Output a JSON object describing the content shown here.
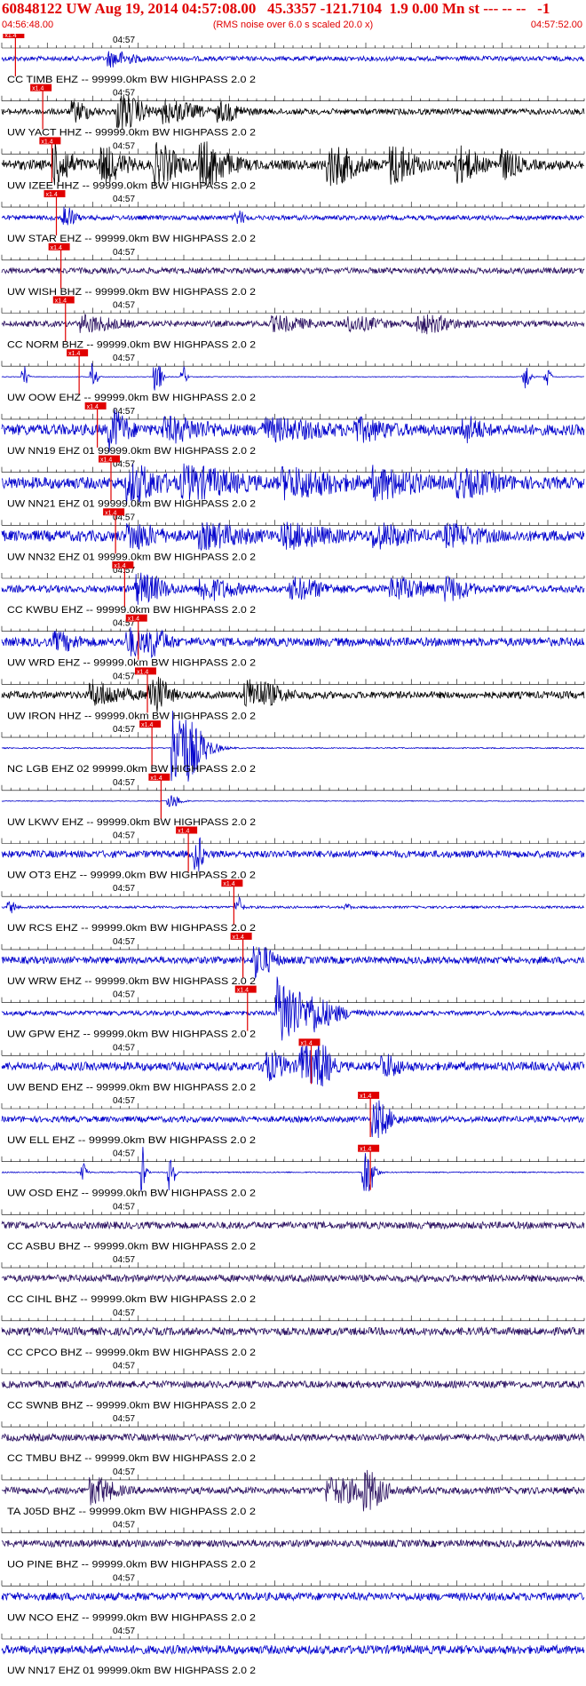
{
  "header": {
    "title": "60848122 UW Aug 19, 2014 04:57:08.00   45.3357 -121.7104  1.9 0.00 Mn st --- -- --   -1",
    "start_time": "04:56:48.00",
    "end_time": "04:57:52.00",
    "subtitle": "(RMS noise over 6.0 s scaled 20.0 x)"
  },
  "colors": {
    "title": "#e00000",
    "blue_trace": "#0000cc",
    "black_trace": "#000000",
    "purple_trace": "#2a1060",
    "pick": "#e00000",
    "tick": "#000000"
  },
  "chart_data": {
    "type": "line",
    "title": "60848122 UW Aug 19, 2014 04:57:08.00   45.3357 -121.7104  1.9 0.00 Mn st --- -- --   -1",
    "subtitle": "(RMS noise over 6.0 s scaled 20.0 x)",
    "xlim": [
      "04:56:48.00",
      "04:57:52.00"
    ],
    "tick_minute_label": "04:57",
    "pick_label": "x1.4",
    "series": [
      {
        "label": "CC TIMB EHZ -- 99999.0km BW  HIGHPASS  2.0  2",
        "color": "blue",
        "pick_s": 1.5,
        "amp": 0.12,
        "events": [
          [
            12,
            0.35,
            2.0
          ]
        ]
      },
      {
        "label": "UW YACT HHZ -- 99999.0km BW  HIGHPASS  2.0  2",
        "color": "black",
        "pick_s": 4.5,
        "amp": 0.15,
        "events": [
          [
            8,
            0.45,
            1.5
          ],
          [
            13,
            0.85,
            2.2
          ],
          [
            18,
            0.5,
            3.0
          ],
          [
            24,
            0.4,
            2.0
          ]
        ]
      },
      {
        "label": "UW IZEE HHZ -- 99999.0km BW  HIGHPASS  2.0  2",
        "color": "black",
        "pick_s": 5.5,
        "amp": 0.25,
        "events": [
          [
            6,
            0.9,
            1.5
          ],
          [
            11,
            0.8,
            2.0
          ],
          [
            17,
            0.9,
            2.0
          ],
          [
            22,
            1.0,
            2.5
          ],
          [
            36,
            0.9,
            2.5
          ],
          [
            43,
            0.9,
            2.0
          ],
          [
            50,
            0.8,
            2.0
          ],
          [
            55,
            0.6,
            1.5
          ]
        ]
      },
      {
        "label": "UW STAR EHZ -- 99999.0km BW  HIGHPASS  2.0  2",
        "color": "blue",
        "pick_s": 6.0,
        "amp": 0.12,
        "events": [
          [
            7,
            0.6,
            0.8
          ],
          [
            26,
            0.3,
            0.6
          ]
        ]
      },
      {
        "label": "UW WISH BHZ -- 99999.0km BW  HIGHPASS  2.0  2",
        "color": "purple",
        "pick_s": 6.5,
        "amp": 0.15,
        "events": []
      },
      {
        "label": "CC NORM BHZ -- 99999.0km BW  HIGHPASS  2.0  2",
        "color": "purple",
        "pick_s": 7.0,
        "amp": 0.15,
        "events": [
          [
            9,
            0.35,
            3.0
          ],
          [
            30,
            0.3,
            3.0
          ],
          [
            38,
            0.3,
            3.0
          ],
          [
            46,
            0.4,
            3.0
          ]
        ]
      },
      {
        "label": "UW OOW EHZ -- 99999.0km BW  HIGHPASS  2.0  2",
        "color": "blue",
        "pick_s": 8.5,
        "amp": 0.02,
        "events": [
          [
            2.5,
            0.6,
            0.3
          ],
          [
            10,
            0.8,
            0.4
          ],
          [
            17,
            0.9,
            0.5
          ],
          [
            20,
            0.5,
            0.3
          ],
          [
            57.5,
            0.7,
            0.5
          ],
          [
            60,
            0.5,
            0.3
          ]
        ]
      },
      {
        "label": "UW NN19 EHZ 01 99999.0km BW  HIGHPASS  2.0  2",
        "color": "blue",
        "pick_s": 10.5,
        "amp": 0.28,
        "events": [
          [
            12,
            0.9,
            1.5
          ],
          [
            18,
            0.45,
            4.0
          ],
          [
            29,
            0.4,
            5.0
          ],
          [
            39,
            0.4,
            3.0
          ],
          [
            51,
            0.5,
            1.5
          ]
        ]
      },
      {
        "label": "UW NN21 EHZ 01 99999.0km BW  HIGHPASS  2.0  2",
        "color": "blue",
        "pick_s": 12.0,
        "amp": 0.3,
        "events": [
          [
            14,
            0.8,
            3.0
          ],
          [
            20,
            0.65,
            5.0
          ],
          [
            31,
            0.6,
            5.0
          ],
          [
            41,
            0.6,
            4.0
          ],
          [
            50,
            0.5,
            4.0
          ]
        ]
      },
      {
        "label": "UW NN32 EHZ 01 99999.0km BW  HIGHPASS  2.0  2",
        "color": "blue",
        "pick_s": 12.5,
        "amp": 0.28,
        "events": [
          [
            14,
            0.55,
            2.5
          ],
          [
            22,
            0.45,
            4.0
          ],
          [
            31,
            0.45,
            4.0
          ],
          [
            41,
            0.45,
            3.0
          ],
          [
            49,
            0.4,
            3.0
          ]
        ]
      },
      {
        "label": "CC KWBU EHZ -- 99999.0km BW  HIGHPASS  2.0  2",
        "color": "blue",
        "pick_s": 13.5,
        "amp": 0.18,
        "events": [
          [
            15,
            0.7,
            2.5
          ],
          [
            22,
            0.5,
            3.0
          ],
          [
            32,
            0.45,
            3.0
          ],
          [
            43,
            0.5,
            3.0
          ],
          [
            49,
            0.5,
            2.0
          ]
        ]
      },
      {
        "label": "UW WRD EHZ -- 99999.0km BW  HIGHPASS  2.0  2",
        "color": "blue",
        "pick_s": 15.0,
        "amp": 0.22,
        "events": [
          [
            6,
            0.35,
            2.0
          ],
          [
            14,
            0.6,
            2.0
          ],
          [
            16.5,
            0.5,
            1.5
          ]
        ]
      },
      {
        "label": "UW IRON HHZ -- 99999.0km BW  HIGHPASS  2.0  2",
        "color": "black",
        "pick_s": 16.0,
        "amp": 0.18,
        "events": [
          [
            10,
            0.5,
            3.0
          ],
          [
            16.5,
            1.0,
            1.5
          ],
          [
            27,
            0.7,
            3.0
          ]
        ]
      },
      {
        "label": "NC LGB EHZ 02 99999.0km BW  HIGHPASS  2.0  2",
        "color": "blue",
        "pick_s": 16.5,
        "amp": 0.03,
        "events": [
          [
            19,
            2.2,
            2.5
          ]
        ]
      },
      {
        "label": "UW LKWV EHZ -- 99999.0km BW  HIGHPASS  2.0  2",
        "color": "blue",
        "pick_s": 17.5,
        "amp": 0.02,
        "events": [
          [
            18.5,
            0.35,
            1.0
          ]
        ]
      },
      {
        "label": "UW OT3 EHZ -- 99999.0km BW  HIGHPASS  2.0  2",
        "color": "blue",
        "pick_s": 20.5,
        "amp": 0.18,
        "events": [
          [
            21.5,
            0.9,
            0.5
          ]
        ]
      },
      {
        "label": "UW RCS EHZ -- 99999.0km BW  HIGHPASS  2.0  2",
        "color": "blue",
        "pick_s": 25.5,
        "amp": 0.06,
        "events": [
          [
            1,
            0.3,
            0.5
          ],
          [
            26,
            0.5,
            0.4
          ],
          [
            38,
            0.15,
            0.3
          ]
        ]
      },
      {
        "label": "UW WRW EHZ -- 99999.0km BW  HIGHPASS  2.0  2",
        "color": "blue",
        "pick_s": 26.5,
        "amp": 0.18,
        "events": [
          [
            28,
            0.8,
            1.5
          ]
        ]
      },
      {
        "label": "UW GPW EHZ -- 99999.0km BW  HIGHPASS  2.0  2",
        "color": "blue",
        "pick_s": 27.0,
        "amp": 0.12,
        "events": [
          [
            30.5,
            1.8,
            2.5
          ],
          [
            34,
            0.6,
            3.0
          ]
        ]
      },
      {
        "label": "UW BEND EHZ -- 99999.0km BW  HIGHPASS  2.0  2",
        "color": "blue",
        "pick_s": 34.0,
        "amp": 0.22,
        "events": [
          [
            29,
            0.6,
            2.0
          ],
          [
            33,
            0.9,
            2.0
          ],
          [
            35,
            0.7,
            1.0
          ],
          [
            42,
            0.5,
            1.5
          ]
        ]
      },
      {
        "label": "UW ELL EHZ -- 99999.0km BW  HIGHPASS  2.0  2",
        "color": "blue",
        "pick_s": 40.5,
        "amp": 0.15,
        "events": [
          [
            41,
            0.9,
            1.5
          ]
        ]
      },
      {
        "label": "UW OSD EHZ -- 99999.0km BW  HIGHPASS  2.0  2",
        "color": "blue",
        "pick_s": 40.5,
        "amp": 0.03,
        "events": [
          [
            9,
            0.7,
            0.3
          ],
          [
            15.5,
            1.3,
            0.3
          ],
          [
            18.5,
            1.2,
            0.4
          ],
          [
            40,
            1.3,
            0.8
          ]
        ]
      },
      {
        "label": "CC ASBU BHZ -- 99999.0km BW  HIGHPASS  2.0  2",
        "color": "purple",
        "pick_s": null,
        "amp": 0.18,
        "events": []
      },
      {
        "label": "CC CIHL BHZ -- 99999.0km BW  HIGHPASS  2.0  2",
        "color": "purple",
        "pick_s": null,
        "amp": 0.18,
        "events": []
      },
      {
        "label": "CC CPCO BHZ -- 99999.0km BW  HIGHPASS  2.0  2",
        "color": "purple",
        "pick_s": null,
        "amp": 0.2,
        "events": []
      },
      {
        "label": "CC SWNB BHZ -- 99999.0km BW  HIGHPASS  2.0  2",
        "color": "purple",
        "pick_s": null,
        "amp": 0.18,
        "events": []
      },
      {
        "label": "CC TMBU BHZ -- 99999.0km BW  HIGHPASS  2.0  2",
        "color": "purple",
        "pick_s": null,
        "amp": 0.18,
        "events": []
      },
      {
        "label": "TA J05D BHZ -- 99999.0km BW  HIGHPASS  2.0  2",
        "color": "purple",
        "pick_s": null,
        "amp": 0.18,
        "events": [
          [
            10,
            0.6,
            2.0
          ],
          [
            36,
            0.55,
            4.5
          ],
          [
            40,
            0.7,
            1.5
          ]
        ]
      },
      {
        "label": "UO PINE BHZ -- 99999.0km BW  HIGHPASS  2.0  2",
        "color": "purple",
        "pick_s": null,
        "amp": 0.18,
        "events": []
      },
      {
        "label": "UW NCO EHZ -- 99999.0km BW  HIGHPASS  2.0  2",
        "color": "blue",
        "pick_s": null,
        "amp": 0.2,
        "events": []
      },
      {
        "label": "UW NN17 EHZ 01 99999.0km BW  HIGHPASS  2.0  2",
        "color": "blue",
        "pick_s": null,
        "amp": 0.22,
        "events": []
      }
    ]
  }
}
